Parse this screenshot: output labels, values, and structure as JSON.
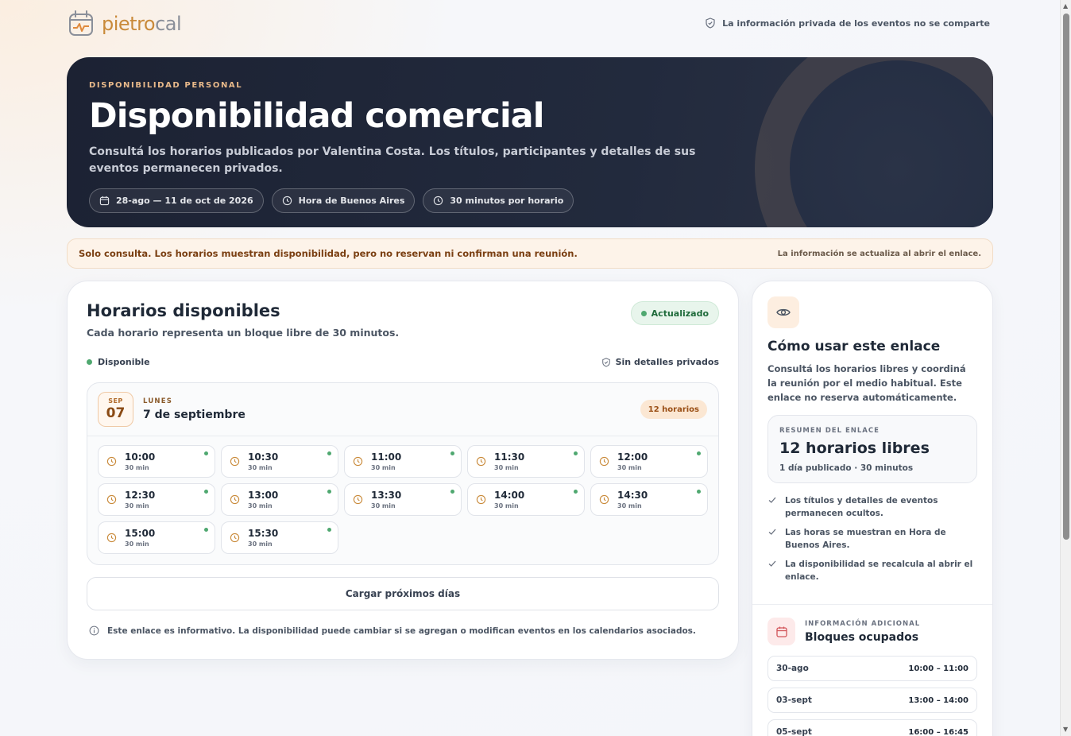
{
  "brand": {
    "name_a": "pietro",
    "name_b": "cal"
  },
  "privacy_note": "La información privada de los eventos no se comparte",
  "hero": {
    "eyebrow": "DISPONIBILIDAD PERSONAL",
    "title": "Disponibilidad comercial",
    "description": "Consultá los horarios publicados por Valentina Costa. Los títulos, participantes y detalles de sus eventos permanecen privados.",
    "chips": [
      {
        "icon": "calendar-icon",
        "label": "28-ago — 11 de oct de 2026"
      },
      {
        "icon": "clock-icon",
        "label": "Hora de Buenos Aires"
      },
      {
        "icon": "clock-icon",
        "label": "30 minutos por horario"
      }
    ]
  },
  "notice": {
    "left": "Solo consulta. Los horarios muestran disponibilidad, pero no reservan ni confirman una reunión.",
    "right": "La información se actualiza al abrir el enlace."
  },
  "main": {
    "title": "Horarios disponibles",
    "subtitle": "Cada horario representa un bloque libre de 30 minutos.",
    "status_badge": "Actualizado",
    "legend_available": "Disponible",
    "legend_private": "Sin detalles privados",
    "day": {
      "month": "SEP",
      "day_num": "07",
      "weekday": "LUNES",
      "full_date": "7 de septiembre",
      "count": "12 horarios"
    },
    "slots": [
      {
        "time": "10:00",
        "dur": "30 min"
      },
      {
        "time": "10:30",
        "dur": "30 min"
      },
      {
        "time": "11:00",
        "dur": "30 min"
      },
      {
        "time": "11:30",
        "dur": "30 min"
      },
      {
        "time": "12:00",
        "dur": "30 min"
      },
      {
        "time": "12:30",
        "dur": "30 min"
      },
      {
        "time": "13:00",
        "dur": "30 min"
      },
      {
        "time": "13:30",
        "dur": "30 min"
      },
      {
        "time": "14:00",
        "dur": "30 min"
      },
      {
        "time": "14:30",
        "dur": "30 min"
      },
      {
        "time": "15:00",
        "dur": "30 min"
      },
      {
        "time": "15:30",
        "dur": "30 min"
      }
    ],
    "load_more": "Cargar próximos días",
    "footnote": "Este enlace es informativo. La disponibilidad puede cambiar si se agregan o modifican eventos en los calendarios asociados."
  },
  "side": {
    "title": "Cómo usar este enlace",
    "description": "Consultá los horarios libres y coordiná la reunión por el medio habitual. Este enlace no reserva automáticamente.",
    "summary_label": "RESUMEN DEL ENLACE",
    "summary_big": "12 horarios libres",
    "summary_small": "1 día publicado · 30 minutos",
    "checks": [
      "Los títulos y detalles de eventos permanecen ocultos.",
      "Las horas se muestran en Hora de Buenos Aires.",
      "La disponibilidad se recalcula al abrir el enlace."
    ],
    "busy_label": "INFORMACIÓN ADICIONAL",
    "busy_title": "Bloques ocupados",
    "busy": [
      {
        "date": "30-ago",
        "range": "10:00 – 11:00"
      },
      {
        "date": "03-sept",
        "range": "13:00 – 14:00"
      },
      {
        "date": "05-sept",
        "range": "16:00 – 16:45"
      }
    ]
  },
  "colors": {
    "accent": "#c98a3a",
    "available": "#4fa870",
    "hero_bg": "#1c2233"
  }
}
